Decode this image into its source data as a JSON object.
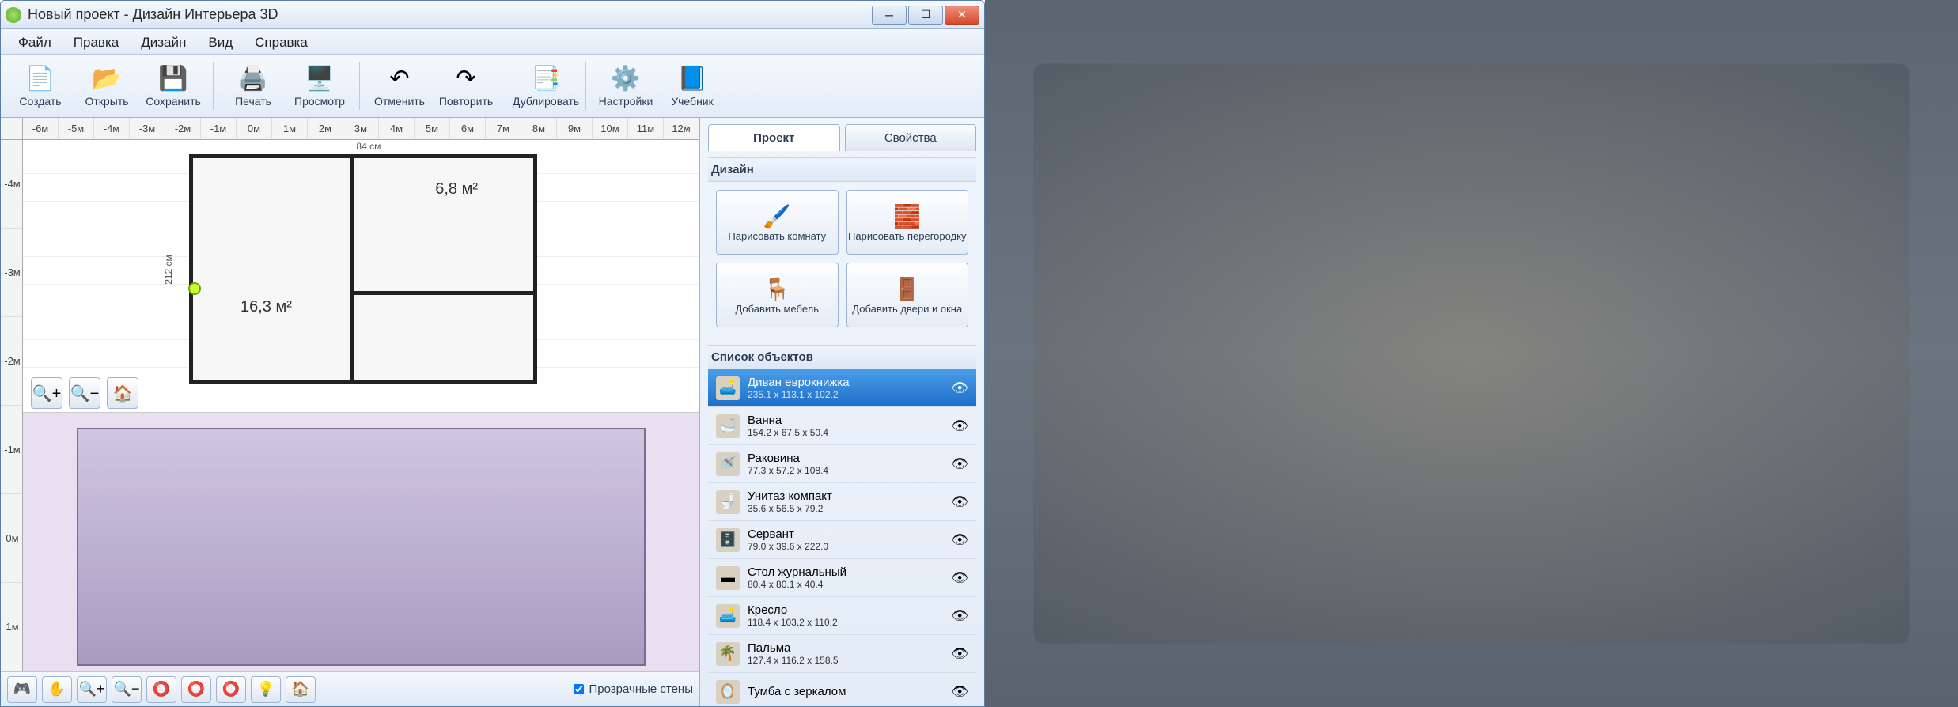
{
  "window": {
    "title": "Новый проект - Дизайн Интерьера 3D"
  },
  "menubar": [
    "Файл",
    "Правка",
    "Дизайн",
    "Вид",
    "Справка"
  ],
  "toolbar": [
    {
      "icon": "📄",
      "label": "Создать"
    },
    {
      "icon": "📂",
      "label": "Открыть"
    },
    {
      "icon": "💾",
      "label": "Сохранить"
    },
    {
      "sep": true
    },
    {
      "icon": "🖨️",
      "label": "Печать"
    },
    {
      "icon": "🖥️",
      "label": "Просмотр"
    },
    {
      "sep": true
    },
    {
      "icon": "↶",
      "label": "Отменить"
    },
    {
      "icon": "↷",
      "label": "Повторить"
    },
    {
      "sep": true
    },
    {
      "icon": "📑",
      "label": "Дублировать"
    },
    {
      "sep": true
    },
    {
      "icon": "⚙️",
      "label": "Настройки"
    },
    {
      "icon": "📘",
      "label": "Учебник"
    }
  ],
  "ruler_h": [
    "-6м",
    "-5м",
    "-4м",
    "-3м",
    "-2м",
    "-1м",
    "0м",
    "1м",
    "2м",
    "3м",
    "4м",
    "5м",
    "6м",
    "7м",
    "8м",
    "9м",
    "10м",
    "11м",
    "12м"
  ],
  "ruler_v": [
    "-4м",
    "-3м",
    "-2м",
    "-1м",
    "0м",
    "1м"
  ],
  "plan": {
    "room_a_label": "16,3 м²",
    "room_b_label": "6,8 м²",
    "dim_left": "212 см",
    "dim_inner": "84 см"
  },
  "zoom_controls": [
    "🔍+",
    "🔍−",
    "🏠"
  ],
  "bottom_toolbar_icons": [
    "🎮",
    "✋",
    "🔍+",
    "🔍−",
    "⭕",
    "⭕",
    "⭕",
    "💡",
    "🏠"
  ],
  "transparent_walls": {
    "checked": true,
    "label": "Прозрачные стены"
  },
  "side": {
    "tabs": [
      {
        "label": "Проект",
        "active": true
      },
      {
        "label": "Свойства",
        "active": false
      }
    ],
    "design_header": "Дизайн",
    "design_buttons": [
      {
        "icon": "🖌️",
        "label": "Нарисовать\nкомнату"
      },
      {
        "icon": "🧱",
        "label": "Нарисовать\nперегородку"
      },
      {
        "icon": "🪑",
        "label": "Добавить\nмебель"
      },
      {
        "icon": "🚪",
        "label": "Добавить\nдвери и окна"
      }
    ],
    "objects_header": "Список объектов",
    "objects": [
      {
        "icon": "🛋️",
        "name": "Диван еврокнижка",
        "dim": "235.1 x 113.1 x 102.2",
        "selected": true
      },
      {
        "icon": "🛁",
        "name": "Ванна",
        "dim": "154.2 x 67.5 x 50.4"
      },
      {
        "icon": "🚿",
        "name": "Раковина",
        "dim": "77.3 x 57.2 x 108.4"
      },
      {
        "icon": "🚽",
        "name": "Унитаз компакт",
        "dim": "35.6 x 56.5 x 79.2"
      },
      {
        "icon": "🗄️",
        "name": "Сервант",
        "dim": "79.0 x 39.6 x 222.0"
      },
      {
        "icon": "▬",
        "name": "Стол журнальный",
        "dim": "80.4 x 80.1 x 40.4"
      },
      {
        "icon": "🛋️",
        "name": "Кресло",
        "dim": "118.4 x 103.2 x 110.2"
      },
      {
        "icon": "🌴",
        "name": "Пальма",
        "dim": "127.4 x 116.2 x 158.5"
      },
      {
        "icon": "🪞",
        "name": "Тумба с зеркалом",
        "dim": ""
      }
    ]
  }
}
